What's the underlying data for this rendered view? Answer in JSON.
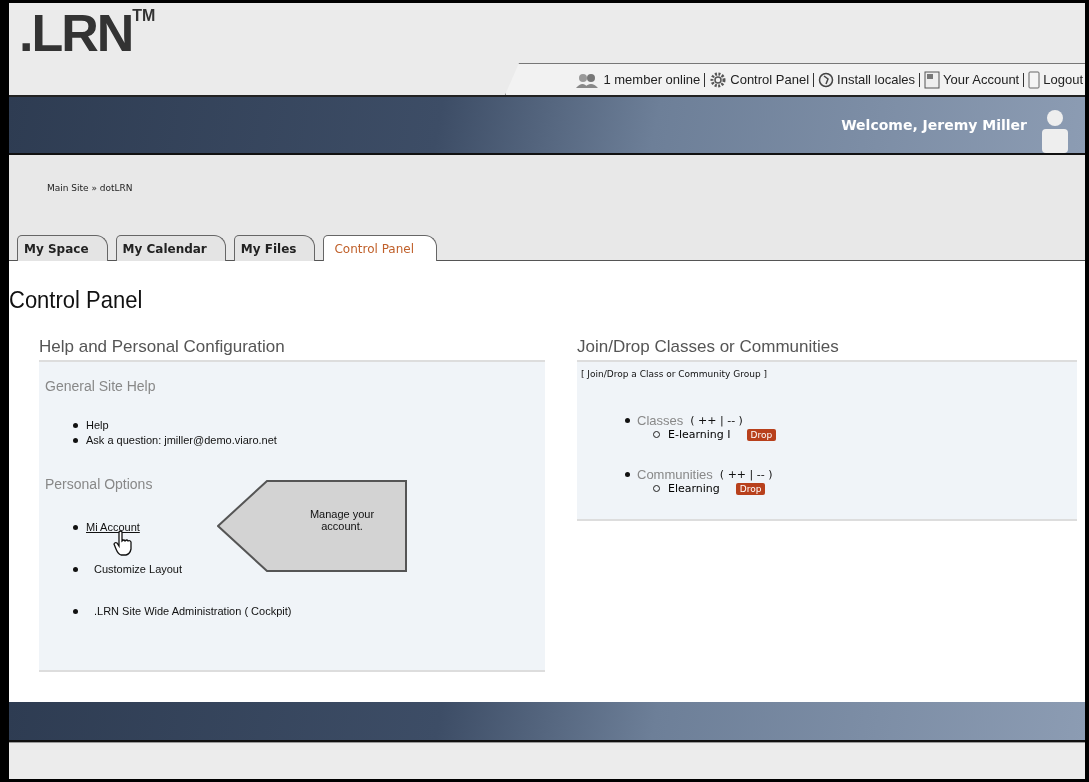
{
  "logo": {
    "text": ".LRN",
    "mark": "TM"
  },
  "top_links": [
    {
      "kind": "members",
      "label": "1 member online"
    },
    {
      "kind": "gear",
      "label": "Control Panel"
    },
    {
      "kind": "globe",
      "label": "Install locales"
    },
    {
      "kind": "account",
      "label": "Your Account"
    },
    {
      "kind": "logout",
      "label": "Logout"
    }
  ],
  "welcome": "Welcome, Jeremy Miller",
  "breadcrumb": "Main Site » dotLRN",
  "tabs": [
    {
      "label": "My Space",
      "selected": false
    },
    {
      "label": "My Calendar",
      "selected": false
    },
    {
      "label": "My Files",
      "selected": false
    },
    {
      "label": "Control Panel",
      "selected": true
    }
  ],
  "page_title": "Control Panel",
  "left_panel": {
    "title": "Help and Personal Configuration",
    "sections": [
      {
        "title": "General Site Help",
        "items": [
          {
            "kind": "text",
            "label": "Help"
          },
          {
            "kind": "text",
            "label": "Ask a question: jmiller@demo.viaro.net"
          }
        ]
      },
      {
        "title": "Personal Options",
        "items": [
          {
            "kind": "link",
            "label": "Mi Account"
          },
          {
            "kind": "text",
            "label": "Customize Layout"
          },
          {
            "kind": "text",
            "label": ".LRN Site Wide Administration ( Cockpit)"
          }
        ]
      }
    ]
  },
  "callout": "Manage your account.",
  "right_panel": {
    "title": "Join/Drop Classes or Communities",
    "link": "[ Join/Drop a Class or Community Group ]",
    "groups": [
      {
        "label": "Classes",
        "controls": "( ++ | -- )",
        "children": [
          {
            "label": "E-learning I",
            "action": "Drop"
          }
        ]
      },
      {
        "label": "Communities",
        "controls": "( ++ | -- )",
        "children": [
          {
            "label": "Elearning",
            "action": "Drop"
          }
        ]
      }
    ]
  }
}
